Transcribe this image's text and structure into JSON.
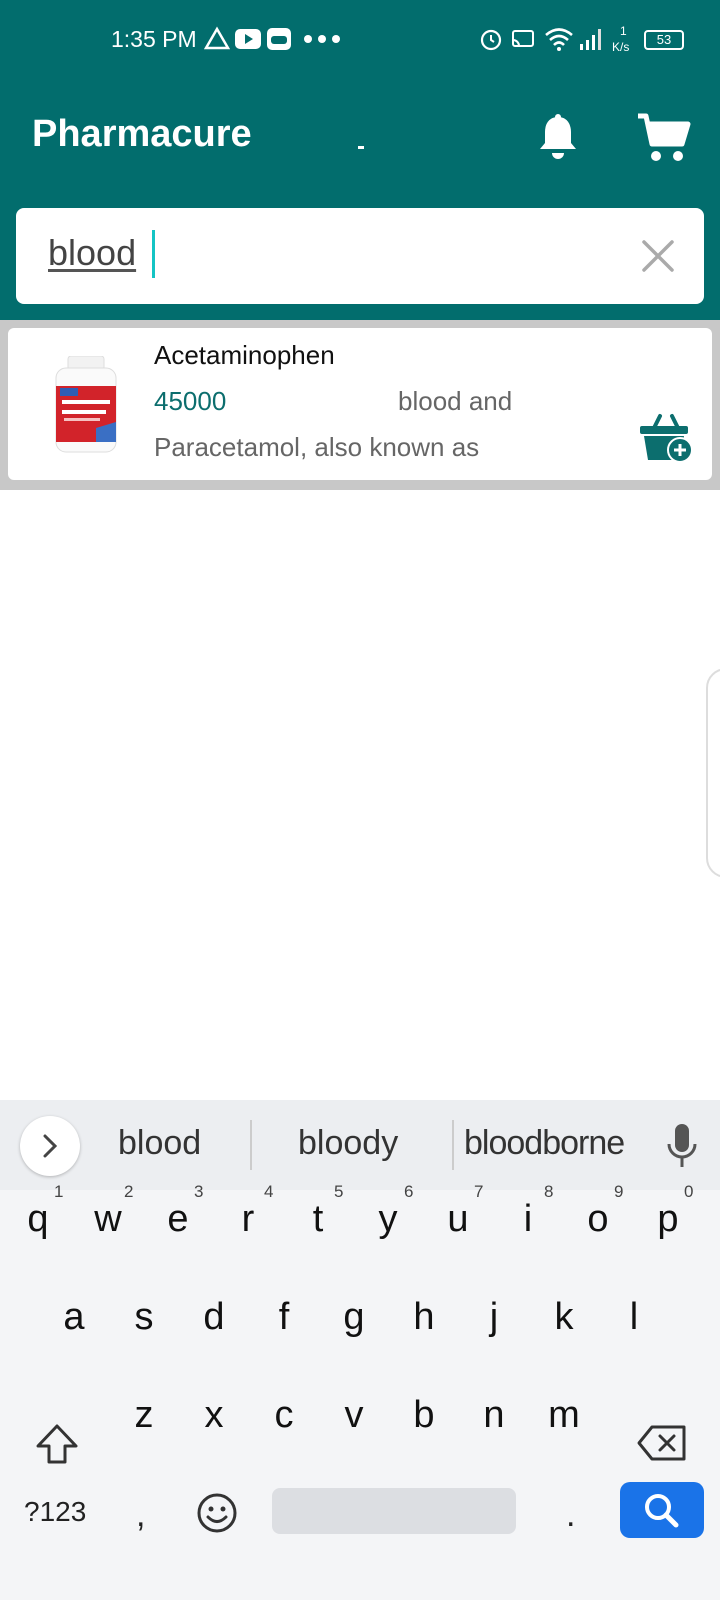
{
  "status_bar": {
    "time": "1:35 PM",
    "net_speed_value": "1",
    "net_speed_unit": "K/s",
    "battery": "53"
  },
  "header": {
    "title": "Pharmacure"
  },
  "search": {
    "value": "blood"
  },
  "results": [
    {
      "name": "Acetaminophen",
      "price": "45000",
      "match_snippet": "blood and",
      "description": "Paracetamol, also known as"
    }
  ],
  "keyboard": {
    "suggestions": [
      "blood",
      "bloody",
      "bloodborne"
    ],
    "row1": [
      {
        "key": "q",
        "hint": "1"
      },
      {
        "key": "w",
        "hint": "2"
      },
      {
        "key": "e",
        "hint": "3"
      },
      {
        "key": "r",
        "hint": "4"
      },
      {
        "key": "t",
        "hint": "5"
      },
      {
        "key": "y",
        "hint": "6"
      },
      {
        "key": "u",
        "hint": "7"
      },
      {
        "key": "i",
        "hint": "8"
      },
      {
        "key": "o",
        "hint": "9"
      },
      {
        "key": "p",
        "hint": "0"
      }
    ],
    "row2": [
      "a",
      "s",
      "d",
      "f",
      "g",
      "h",
      "j",
      "k",
      "l"
    ],
    "row3": [
      "z",
      "x",
      "c",
      "v",
      "b",
      "n",
      "m"
    ],
    "symbols_label": "?123",
    "comma_label": ",",
    "period_label": "."
  },
  "colors": {
    "header": "#026d6d",
    "price": "#0c6e6e",
    "caret": "#14c4c4",
    "search_key": "#1a73e8"
  }
}
